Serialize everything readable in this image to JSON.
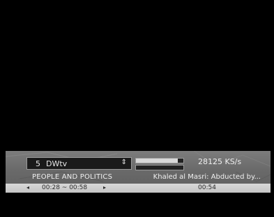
{
  "channel": {
    "number": "5",
    "name": "DWtv",
    "arrows": "⇕"
  },
  "signal": {
    "strength_fraction": 0.88,
    "quality_fraction": 0.0,
    "symbol_rate": "28125 KS/s"
  },
  "program": {
    "current_title": "PEOPLE AND POLITICS",
    "next_title": "Khaled al Masri: Abducted by..."
  },
  "time": {
    "prev_arrow": "◂",
    "range": "00:28 ~ 00:58",
    "next_arrow": "▸",
    "current": "00:54"
  },
  "colors": {
    "banner": "#6a6a6a",
    "channel_box": "#1a1a1a",
    "time_strip": "#d0d0d0"
  }
}
